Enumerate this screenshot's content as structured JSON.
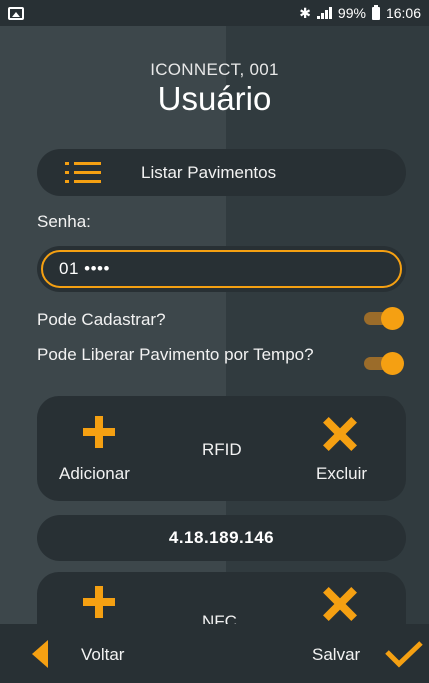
{
  "status_bar": {
    "battery": "99%",
    "time": "16:06"
  },
  "header": {
    "device": "ICONNECT, 001",
    "title": "Usuário"
  },
  "list_button": {
    "label": "Listar Pavimentos"
  },
  "password": {
    "label": "Senha:",
    "value": "01 ••••"
  },
  "options": [
    {
      "label": "Pode Cadastrar?",
      "enabled": true
    },
    {
      "label": "Pode Liberar Pavimento por Tempo?",
      "enabled": true
    }
  ],
  "rfid": {
    "title": "RFID",
    "add_label": "Adicionar",
    "delete_label": "Excluir",
    "ip": "4.18.189.146"
  },
  "nfc": {
    "title": "NFC"
  },
  "bottom_bar": {
    "back_label": "Voltar",
    "save_label": "Salvar"
  },
  "colors": {
    "accent": "#f5a012",
    "panel": "#283034",
    "background": "#384246"
  }
}
